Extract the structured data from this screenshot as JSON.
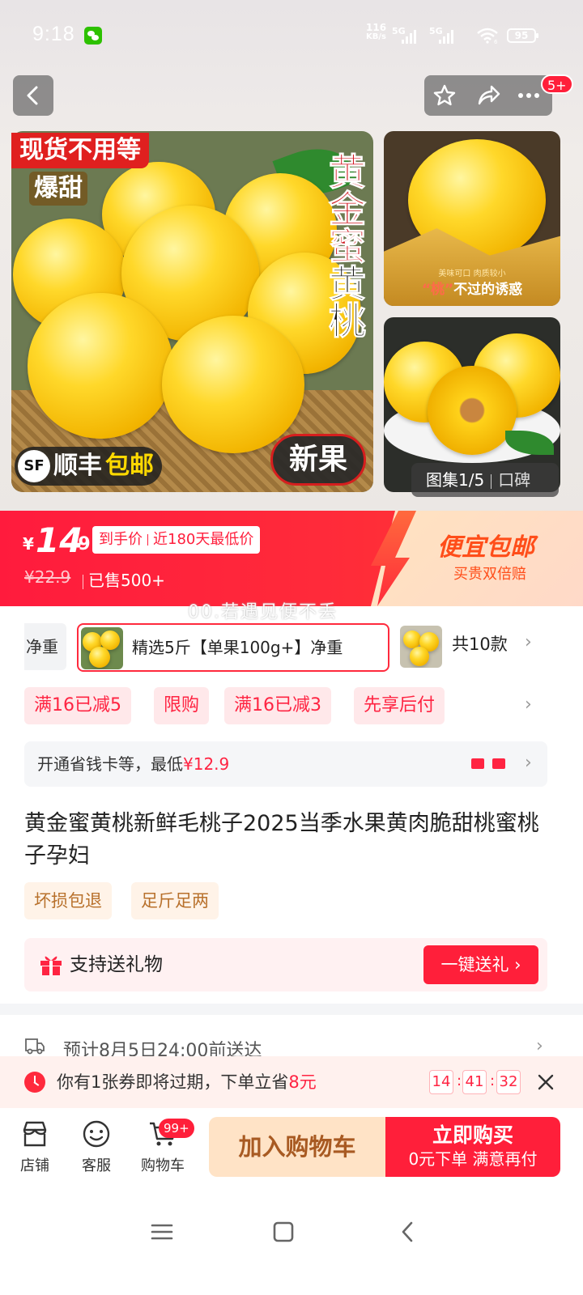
{
  "status_bar": {
    "time": "9:18",
    "net_speed_value": "116",
    "net_speed_unit": "KB/s",
    "signal1_label": "5G",
    "signal2_label": "5G",
    "wifi_sub": "6",
    "battery": "95"
  },
  "header": {
    "badge": "5+"
  },
  "gallery": {
    "main_tag": "现货不用等",
    "main_subtag": "爆甜",
    "vertical_title_red": "黄金蜜",
    "vertical_title_black": "黄桃",
    "sf_logo": "SF",
    "sf_text": "顺丰",
    "sf_free": "包邮",
    "new_badge": "新果",
    "thumb1_small": "美味可口 肉质较小",
    "thumb1_caption_hl": "“桃”",
    "thumb1_caption": "不过的诱惑",
    "counter_label": "图集1/5",
    "counter_extra": "口碑"
  },
  "price": {
    "currency": "¥",
    "integer": "14",
    "decimal": ".9",
    "tag_part1": "到手价",
    "tag_part2": "近180天最低价",
    "original": "¥22.9",
    "sold": "已售500+",
    "promo_title": "便宜包邮",
    "promo_sub": "买贵双倍赔",
    "watermark": "00.若遇见便不丢"
  },
  "sku": {
    "prev_label": "净重",
    "selected_label": "精选5斤【单果100g+】净重",
    "count_label": "共10款"
  },
  "promos": [
    "满16已减5",
    "限购",
    "满16已减3",
    "先享后付"
  ],
  "card": {
    "text": "开通省钱卡等，最低",
    "price": "¥12.9"
  },
  "product": {
    "title": "黄金蜜黄桃新鲜毛桃子2025当季水果黄肉脆甜桃蜜桃子孕妇",
    "features": [
      "坏损包退",
      "足斤足两"
    ]
  },
  "gift": {
    "text": "支持送礼物",
    "button": "一键送礼 ›"
  },
  "delivery": {
    "text": "预计8月5日24:00前送达"
  },
  "coupon": {
    "text": "你有1张券即将过期，下单立省",
    "amount": "8元",
    "countdown": [
      "14",
      "41",
      "32"
    ]
  },
  "bottom_nav": {
    "store": "店铺",
    "service": "客服",
    "cart": "购物车",
    "cart_badge": "99+",
    "add_cart": "加入购物车",
    "buy_now": "立即购买",
    "buy_now_sub": "0元下单 满意再付"
  },
  "colors": {
    "brand_red": "#ff1f3a",
    "price_banner": "#ff2a3a",
    "promo_bg": "#ffe8ea"
  }
}
